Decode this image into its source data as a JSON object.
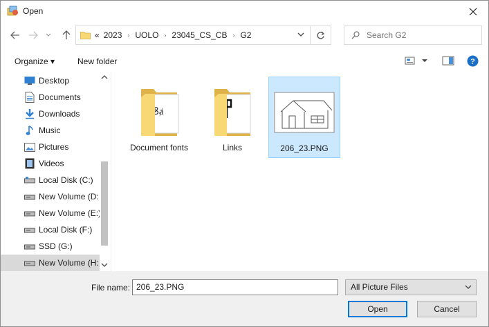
{
  "window": {
    "title": "Open"
  },
  "address": {
    "overflow": "«",
    "crumbs": [
      "2023",
      "UOLO",
      "23045_CS_CB",
      "G2"
    ]
  },
  "search": {
    "placeholder": "Search G2"
  },
  "commands": {
    "organize": "Organize ▾",
    "new_folder": "New folder"
  },
  "nav_items": [
    {
      "label": "Desktop",
      "icon": "desktop-icon"
    },
    {
      "label": "Documents",
      "icon": "documents-icon"
    },
    {
      "label": "Downloads",
      "icon": "downloads-icon"
    },
    {
      "label": "Music",
      "icon": "music-icon"
    },
    {
      "label": "Pictures",
      "icon": "pictures-icon"
    },
    {
      "label": "Videos",
      "icon": "videos-icon"
    },
    {
      "label": "Local Disk (C:)",
      "icon": "drive-icon"
    },
    {
      "label": "New Volume (D:",
      "icon": "drive-icon"
    },
    {
      "label": "New Volume (E:)",
      "icon": "drive-icon"
    },
    {
      "label": "Local Disk (F:)",
      "icon": "drive-icon"
    },
    {
      "label": "SSD (G:)",
      "icon": "drive-icon"
    },
    {
      "label": "New Volume (H:",
      "icon": "drive-icon"
    }
  ],
  "files": [
    {
      "name": "Document fonts",
      "type": "folder"
    },
    {
      "name": "Links",
      "type": "folder"
    },
    {
      "name": "206_23.PNG",
      "type": "image"
    }
  ],
  "footer": {
    "file_name_label": "File name:",
    "file_name_value": "206_23.PNG",
    "file_type": "All Picture Files",
    "open_label": "Open",
    "cancel_label": "Cancel"
  },
  "colors": {
    "accent": "#0078d7",
    "selection": "#cce8ff",
    "folder": "#f8d775",
    "help": "#1a6fc7"
  }
}
